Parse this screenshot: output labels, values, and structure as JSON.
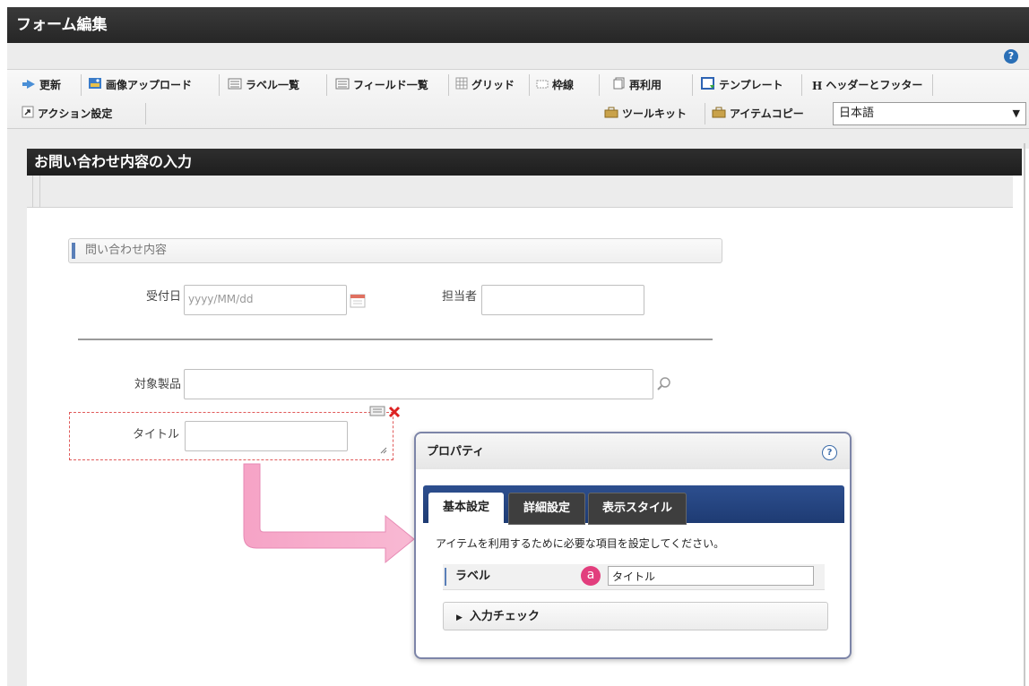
{
  "window": {
    "title": "フォーム編集"
  },
  "help": {
    "glyph": "?"
  },
  "toolbar": {
    "row1": [
      {
        "id": "update",
        "label": "更新",
        "icon": "update-icon"
      },
      {
        "id": "image-upload",
        "label": "画像アップロード",
        "icon": "image-upload-icon"
      },
      {
        "id": "label-list",
        "label": "ラベル一覧",
        "icon": "label-list-icon"
      },
      {
        "id": "field-list",
        "label": "フィールド一覧",
        "icon": "field-list-icon"
      },
      {
        "id": "grid",
        "label": "グリッド",
        "icon": "grid-icon"
      },
      {
        "id": "frame-line",
        "label": "枠線",
        "icon": "frame-line-icon"
      },
      {
        "id": "reuse",
        "label": "再利用",
        "icon": "reuse-icon"
      },
      {
        "id": "template",
        "label": "テンプレート",
        "icon": "template-icon"
      },
      {
        "id": "header-footer",
        "label": "ヘッダーとフッター",
        "icon": "header-footer-icon"
      }
    ],
    "row2": {
      "action": "アクション設定",
      "toolkit": "ツールキット",
      "item_copy": "アイテムコピー",
      "language": "日本語"
    }
  },
  "form": {
    "header": "お問い合わせ内容の入力",
    "section": "問い合わせ内容",
    "fields": {
      "received_date_label": "受付日",
      "received_date_placeholder": "yyyy/MM/dd",
      "assignee_label": "担当者",
      "product_label": "対象製品",
      "title_label": "タイトル"
    }
  },
  "properties": {
    "title": "プロパティ",
    "help": "?",
    "tabs": [
      "基本設定",
      "詳細設定",
      "表示スタイル"
    ],
    "description": "アイテムを利用するために必要な項目を設定してください。",
    "label_name": "ラベル",
    "badge": "a",
    "label_value": "タイトル",
    "input_check": "入力チェック"
  },
  "colors": {
    "title_bar": "#2b2b2b",
    "tab_bar": "#244585",
    "badge": "#e23e7d",
    "arrow": "#f7a7c8",
    "selection_border": "#e05a5a"
  }
}
